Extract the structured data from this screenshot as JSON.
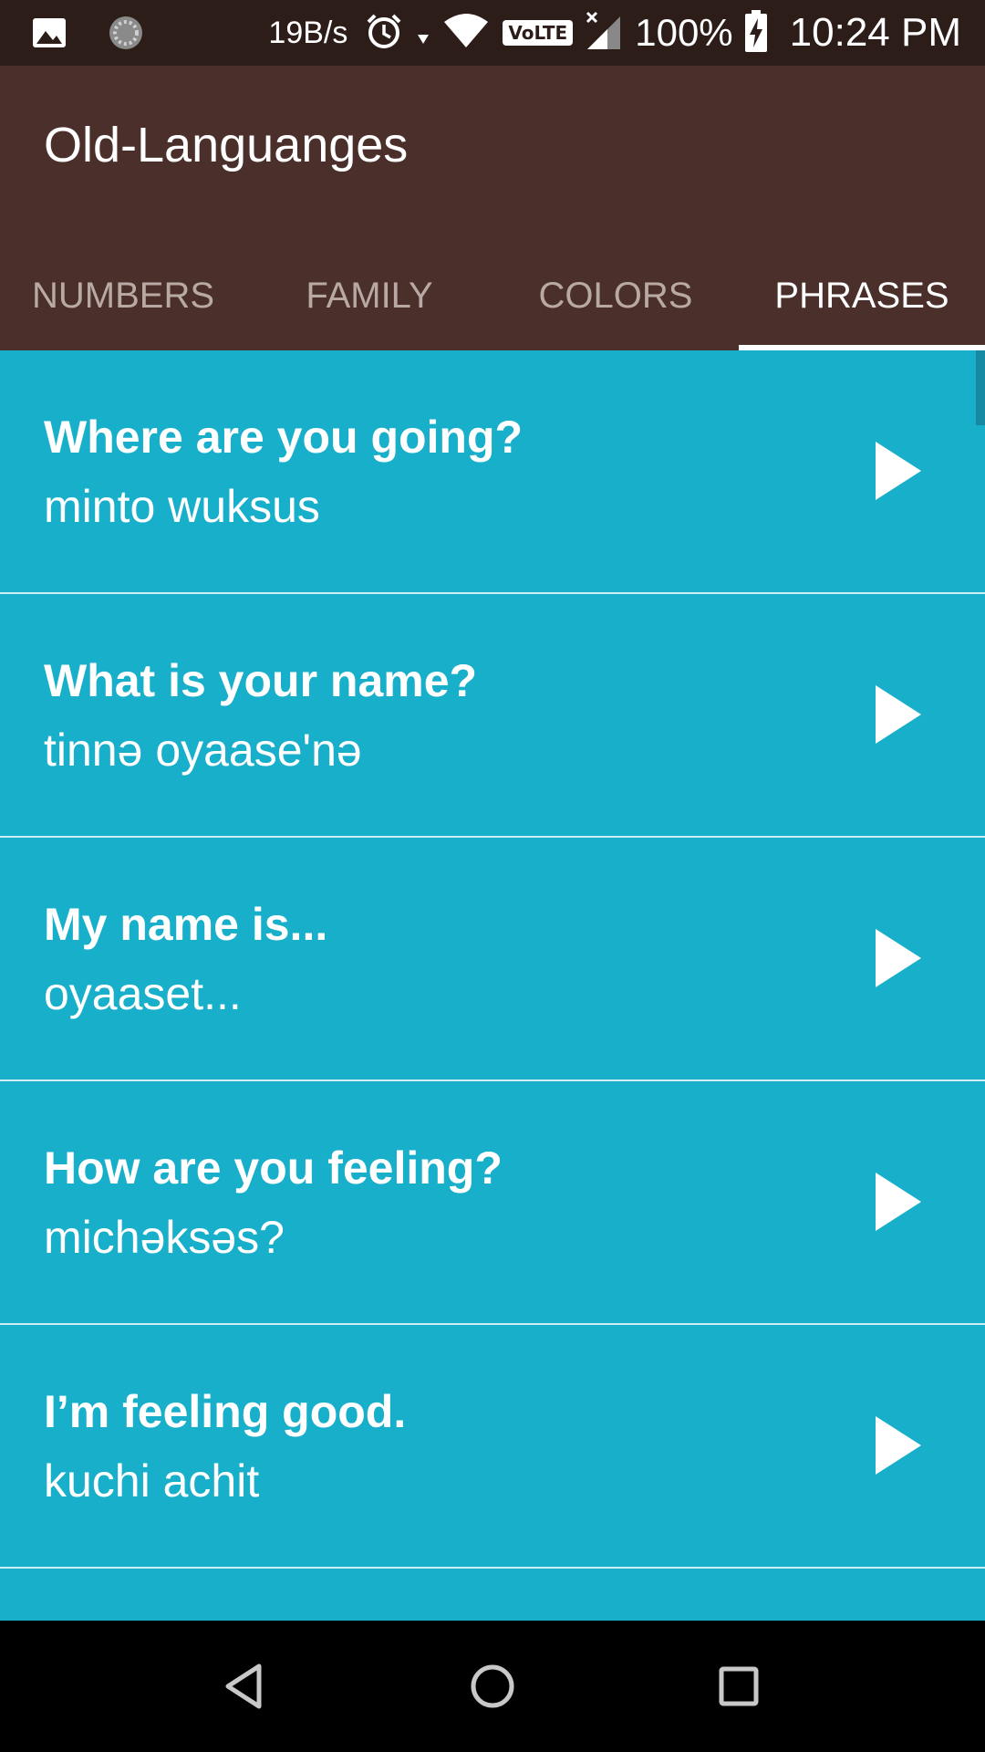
{
  "status_bar": {
    "net_speed": "19B/s",
    "network_type": "VoLTE",
    "battery": "100%",
    "time": "10:24 PM",
    "icons": [
      "image-icon",
      "sync-icon",
      "alarm-icon",
      "data-arrow-icon",
      "wifi-icon",
      "volte-icon",
      "signal-icon",
      "battery-charging-icon"
    ]
  },
  "app": {
    "title": "Old-Languanges"
  },
  "tabs": [
    {
      "label": "NUMBERS",
      "active": false
    },
    {
      "label": "FAMILY",
      "active": false
    },
    {
      "label": "COLORS",
      "active": false
    },
    {
      "label": "PHRASES",
      "active": true
    }
  ],
  "phrases": [
    {
      "english": "Where are you going?",
      "native": "minto wuksus"
    },
    {
      "english": "What is your name?",
      "native": "tinnə oyaase'nə"
    },
    {
      "english": "My name is...",
      "native": "oyaaset..."
    },
    {
      "english": "How are you feeling?",
      "native": "michəksəs?"
    },
    {
      "english": "I’m feeling good.",
      "native": "kuchi achit"
    }
  ],
  "colors": {
    "status_bar": "#2C1D19",
    "app_bar": "#4A2F2A",
    "list_background": "#18AFCB",
    "tab_inactive": "#B9A9A4",
    "tab_active": "#FFFFFF",
    "nav_bar": "#000000"
  },
  "nav": [
    "back-icon",
    "home-icon",
    "recents-icon"
  ]
}
